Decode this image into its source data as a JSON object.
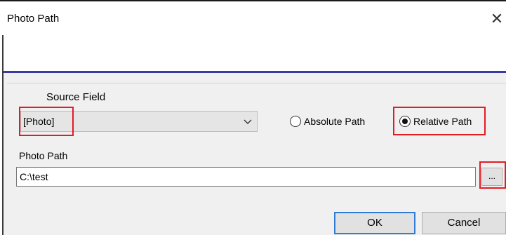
{
  "window": {
    "title": "Photo Path",
    "close_glyph": "✕"
  },
  "source": {
    "label": "Source Field",
    "value": "[Photo]"
  },
  "path_type": {
    "absolute_label": "Absolute Path",
    "relative_label": "Relative Path",
    "selected": "relative"
  },
  "photo_path": {
    "label": "Photo Path",
    "value": "C:\\test",
    "browse_label": "..."
  },
  "buttons": {
    "ok": "OK",
    "cancel": "Cancel"
  },
  "colors": {
    "highlight": "#e31b23",
    "header_rule": "#3b3ba6",
    "default_button_border": "#2f7cd6"
  }
}
